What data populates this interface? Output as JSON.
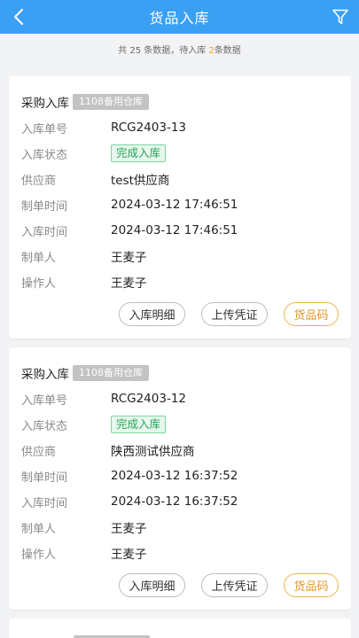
{
  "header": {
    "title": "货品入库",
    "back_icon": "chevron-left-icon",
    "filter_icon": "filter-icon"
  },
  "summary": {
    "prefix": "共 25 条数据，待入库 ",
    "pending": "2",
    "suffix": "条数据"
  },
  "labels": {
    "order_no": "入库单号",
    "status": "入库状态",
    "supplier": "供应商",
    "created_time": "制单时间",
    "stock_in_time": "入库时间",
    "creator": "制单人",
    "operator": "操作人"
  },
  "buttons": {
    "detail": "入库明细",
    "upload": "上传凭证",
    "code": "货品码"
  },
  "colors": {
    "primary": "#3aa0f4",
    "status_green": "#29a35a",
    "accent_orange": "#e0962a"
  },
  "records": [
    {
      "type": "采购入库",
      "warehouse": "1108备用仓库",
      "order_no": "RCG2403-13",
      "status": "完成入库",
      "supplier": "test供应商",
      "created_time": "2024-03-12 17:46:51",
      "stock_in_time": "2024-03-12 17:46:51",
      "creator": "王麦子",
      "operator": "王麦子"
    },
    {
      "type": "采购入库",
      "warehouse": "1108备用仓库",
      "order_no": "RCG2403-12",
      "status": "完成入库",
      "supplier": "陕西测试供应商",
      "created_time": "2024-03-12 16:37:52",
      "stock_in_time": "2024-03-12 16:37:52",
      "creator": "王麦子",
      "operator": "王麦子"
    }
  ]
}
